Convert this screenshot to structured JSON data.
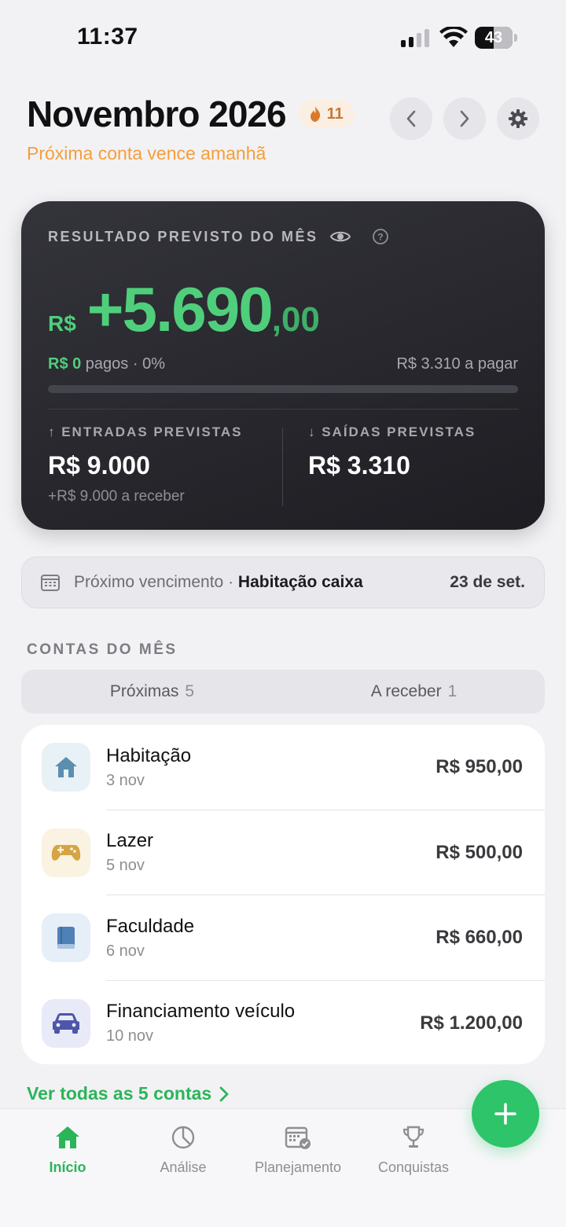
{
  "status_bar": {
    "time": "11:37",
    "battery": "43"
  },
  "header": {
    "title": "Novembro 2026",
    "streak_count": "11",
    "subtitle": "Próxima conta vence amanhã"
  },
  "result_card": {
    "label": "RESULTADO PREVISTO DO MÊS",
    "currency": "R$",
    "amount_main": "+5.690",
    "amount_cents": ",00",
    "paid_amount": "R$ 0",
    "paid_text": " pagos · 0%",
    "to_pay": "R$ 3.310 a pagar",
    "paid_fraction": 0,
    "income_label": "↑ ENTRADAS PREVISTAS",
    "income_value": "R$ 9.000",
    "income_sub": "+R$ 9.000 a receber",
    "expenses_label": "↓ SAÍDAS PREVISTAS",
    "expenses_value": "R$ 3.310"
  },
  "next_due": {
    "label": "Próximo vencimento · ",
    "name": "Habitação caixa",
    "date": "23 de set."
  },
  "section_title": "CONTAS DO MÊS",
  "segments": [
    {
      "label": "Próximas",
      "count": "5"
    },
    {
      "label": "A receber",
      "count": "1"
    }
  ],
  "bills": [
    {
      "name": "Habitação",
      "date": "3 nov",
      "amount": "R$ 950,00",
      "icon": "house-icon",
      "color": "#5b8fb0",
      "bg": "#e8f1f5"
    },
    {
      "name": "Lazer",
      "date": "5 nov",
      "amount": "R$ 500,00",
      "icon": "gamepad-icon",
      "color": "#d5a444",
      "bg": "#faf3e2"
    },
    {
      "name": "Faculdade",
      "date": "6 nov",
      "amount": "R$ 660,00",
      "icon": "book-icon",
      "color": "#4f80b8",
      "bg": "#e6eef8"
    },
    {
      "name": "Financiamento veículo",
      "date": "10 nov",
      "amount": "R$ 1.200,00",
      "icon": "car-icon",
      "color": "#4d56a8",
      "bg": "#e9eaf7"
    }
  ],
  "see_all": "Ver todas as 5 contas",
  "tabs": [
    {
      "label": "Início",
      "icon": "home-icon",
      "active": true
    },
    {
      "label": "Análise",
      "icon": "chart-pie-icon",
      "active": false
    },
    {
      "label": "Planejamento",
      "icon": "calendar-check-icon",
      "active": false
    },
    {
      "label": "Conquistas",
      "icon": "trophy-icon",
      "active": false
    }
  ],
  "colors": {
    "accent_green": "#2ec46a",
    "warning_orange": "#f59e3a",
    "card_dark": "#1d1d22"
  }
}
